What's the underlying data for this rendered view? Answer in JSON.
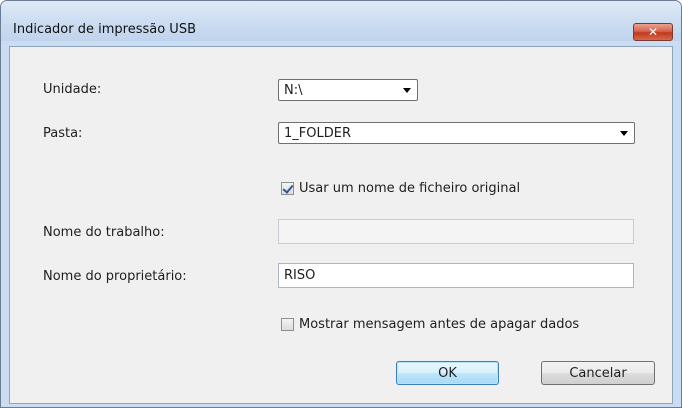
{
  "window": {
    "title": "Indicador de impressão USB",
    "close_glyph": "✕"
  },
  "form": {
    "unit_label": "Unidade:",
    "unit_value": "N:\\",
    "folder_label": "Pasta:",
    "folder_value": "1_FOLDER",
    "use_original_label": "Usar um nome de ficheiro original",
    "use_original_checked": true,
    "job_name_label": "Nome do trabalho:",
    "job_name_value": "",
    "owner_label": "Nome do proprietário:",
    "owner_value": "RISO",
    "confirm_delete_label": "Mostrar mensagem antes de apagar dados",
    "confirm_delete_checked": false
  },
  "buttons": {
    "ok": "OK",
    "cancel": "Cancelar"
  },
  "icons": {
    "close": "close-icon",
    "dropdown": "chevron-down-icon",
    "check": "checkbox-icon"
  }
}
